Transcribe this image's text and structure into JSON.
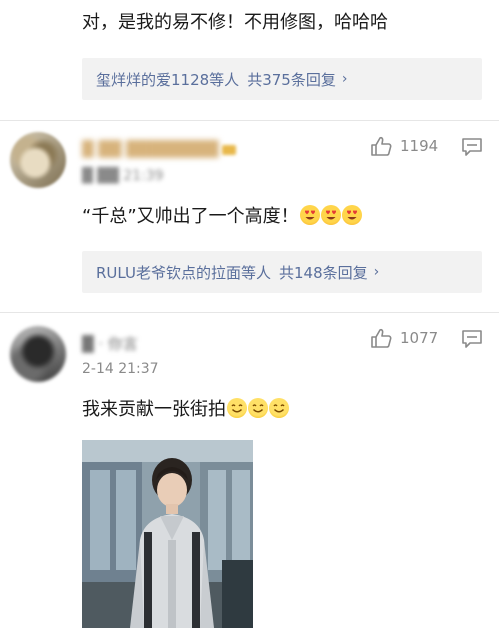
{
  "comment0": {
    "text": "对，是我的易不修！不用修图，哈哈哈",
    "replies": {
      "users": "玺烊烊的爱1128等人",
      "count": "共375条回复",
      "arrow": "›"
    }
  },
  "comment1": {
    "username": "█ ██ ████████",
    "time": "█ ██ 21:39",
    "likes": "1194",
    "text": "“千总”又帅出了一个高度！",
    "replies": {
      "users": "RULU老爷钦点的拉面等人",
      "count": "共148条回复",
      "arrow": "›"
    }
  },
  "comment2": {
    "username": "█ · 你言",
    "time": "2-14 21:37",
    "likes": "1077",
    "text": "我来贡献一张街拍"
  },
  "colors": {
    "link": "#5a6f9c",
    "meta": "#8a8a8a",
    "reply_bg": "#f2f2f2",
    "divider": "#e6e6e6"
  },
  "icons": {
    "like": "thumbs-up-icon",
    "comment": "comment-bubble-icon",
    "emoji_love": "heart-eyes-emoji",
    "emoji_smile": "smiling-face-emoji"
  }
}
